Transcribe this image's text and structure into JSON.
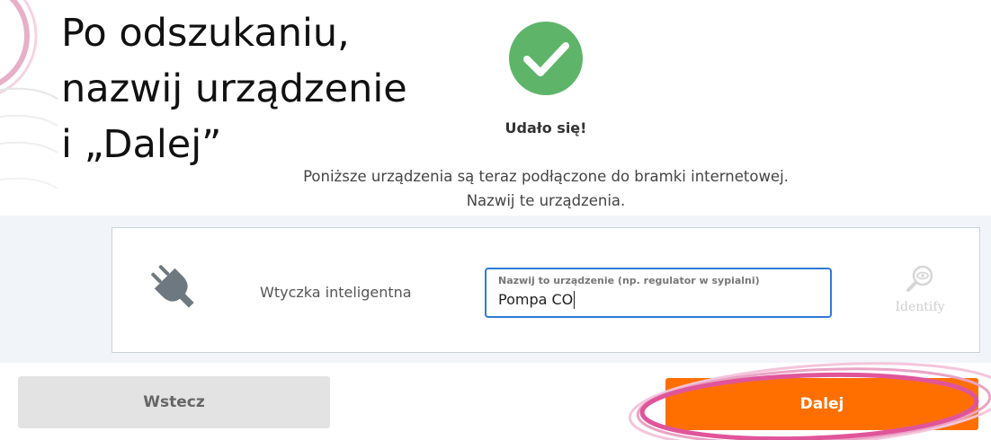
{
  "slide": {
    "title": "Po odszukaniu,\nnazwij urządzenie\n i „Dalej”"
  },
  "success": {
    "icon": "check-circle-icon",
    "title": "Udało się!",
    "description": "Poniższe urządzenia są teraz podłączone do bramki internetowej. Nazwij te urządzenia."
  },
  "device": {
    "icon": "plug-icon",
    "type_label": "Wtyczka inteligentna",
    "name_field": {
      "label": "Nazwij to urządzenie (np. regulator w sypialni)",
      "value": "Pompa CO"
    },
    "identify": {
      "icon": "eye-magnifier-icon",
      "label": "Identify"
    }
  },
  "buttons": {
    "back_label": "Wstecz",
    "next_label": "Dalej"
  },
  "colors": {
    "success_green": "#5eb56a",
    "next_orange": "#ff6f00",
    "field_focus_blue": "#2f7bd8",
    "highlight_pink": "#e0559a"
  }
}
